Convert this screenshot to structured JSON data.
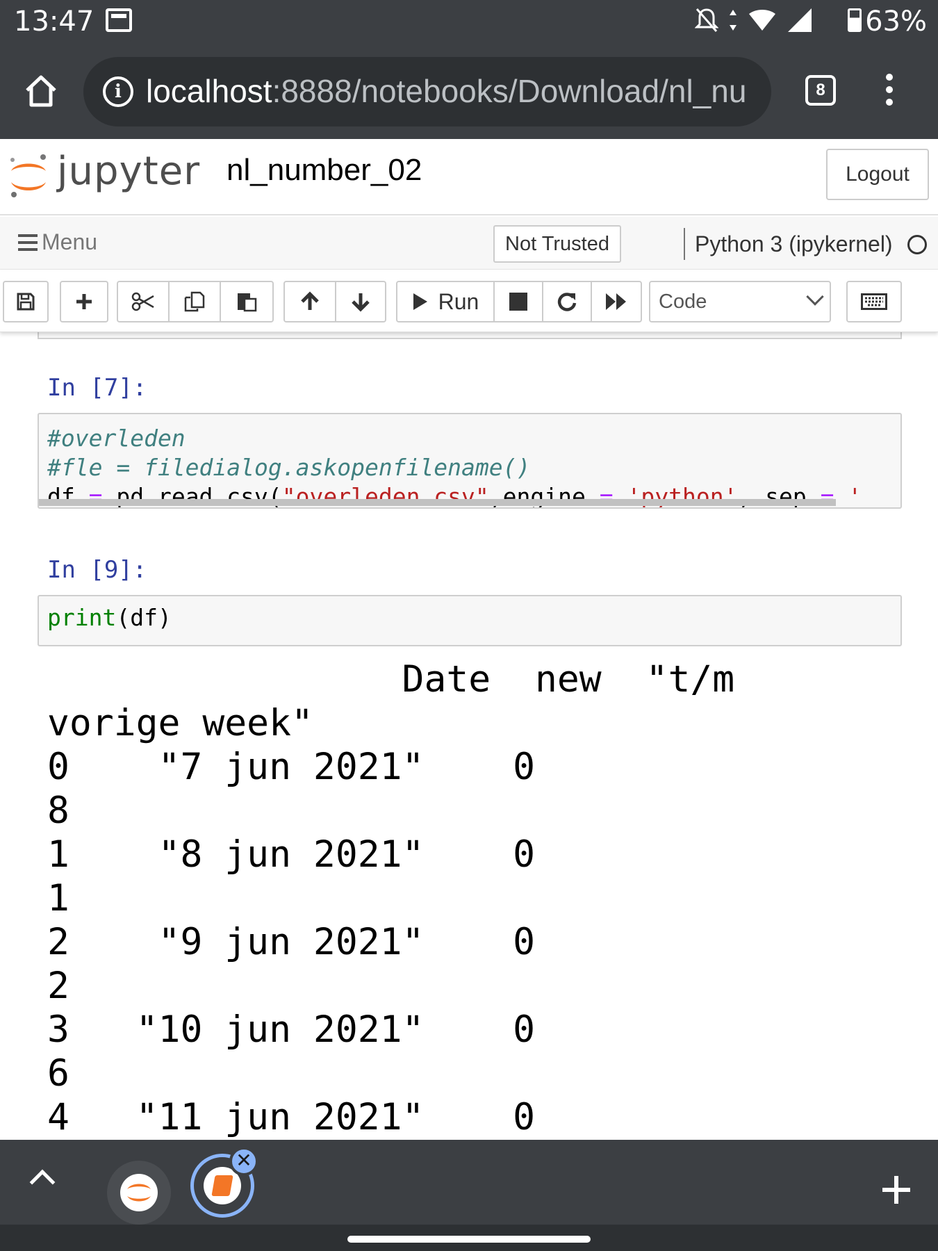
{
  "status_bar": {
    "time": "13:47",
    "battery": "63%"
  },
  "browser": {
    "url_host": "localhost",
    "url_path": ":8888/notebooks/Download/nl_nu",
    "tab_count": "8"
  },
  "jupyter": {
    "logo_text": "jupyter",
    "notebook_name": "nl_number_02",
    "logout_label": "Logout",
    "menu_label": "Menu",
    "trusted_label": "Not Trusted",
    "kernel_label": "Python 3 (ipykernel)"
  },
  "toolbar": {
    "run_label": "Run",
    "cell_type": "Code",
    "icons": [
      "save-icon",
      "plus-icon",
      "cut-icon",
      "copy-icon",
      "paste-icon",
      "arrow-up-icon",
      "arrow-down-icon",
      "run-icon",
      "stop-icon",
      "restart-icon",
      "fast-forward-icon",
      "keyboard-icon"
    ]
  },
  "cells": [
    {
      "prompt": "In [7]:",
      "lines": [
        [
          {
            "t": "#overleden",
            "c": "comment"
          }
        ],
        [
          {
            "t": "#fle = filedialog.askopenfilename()",
            "c": "comment"
          }
        ],
        [
          {
            "t": "df ",
            "c": ""
          },
          {
            "t": "=",
            "c": "op"
          },
          {
            "t": " pd.read_csv(",
            "c": ""
          },
          {
            "t": "\"overleden.csv\"",
            "c": "str"
          },
          {
            "t": ",engine ",
            "c": ""
          },
          {
            "t": "=",
            "c": "op"
          },
          {
            "t": " ",
            "c": ""
          },
          {
            "t": "'python'",
            "c": "str"
          },
          {
            "t": ", sep ",
            "c": ""
          },
          {
            "t": "=",
            "c": "op"
          },
          {
            "t": " '",
            "c": "str"
          }
        ]
      ]
    },
    {
      "prompt": "In [9]:",
      "lines": [
        [
          {
            "t": "print",
            "c": "builtin"
          },
          {
            "t": "(df)",
            "c": ""
          }
        ]
      ]
    }
  ],
  "output": {
    "lines": [
      "                Date  new  \"t/m",
      "vorige week\"",
      "0    \"7 jun 2021\"    0",
      "8",
      "1    \"8 jun 2021\"    0",
      "1",
      "2    \"9 jun 2021\"    0",
      "2",
      "3   \"10 jun 2021\"    0",
      "6",
      "4   \"11 jun 2021\"    0"
    ]
  }
}
